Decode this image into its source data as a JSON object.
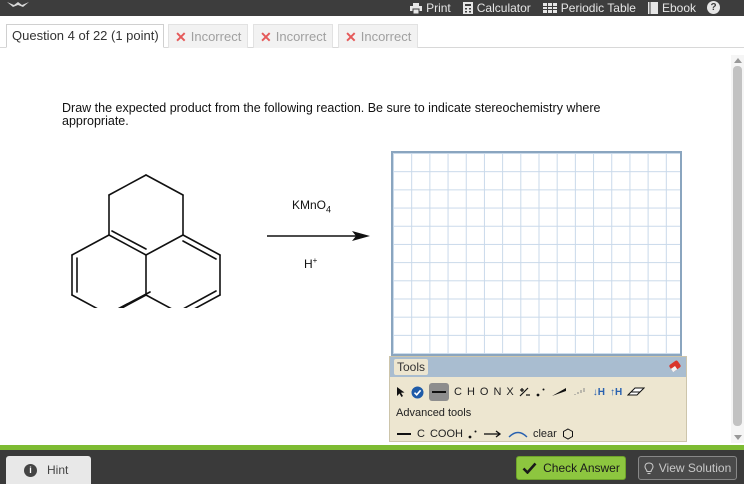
{
  "topbar": {
    "logo_icon": "bird-logo-icon",
    "tools": [
      {
        "label": "Print",
        "icon": "printer-icon"
      },
      {
        "label": "Calculator",
        "icon": "calculator-icon"
      },
      {
        "label": "Periodic Table",
        "icon": "periodic-table-icon"
      },
      {
        "label": "Ebook",
        "icon": "book-icon"
      }
    ],
    "help_glyph": "?"
  },
  "tabs": {
    "active": "Question 4 of 22 (1 point)",
    "attempts": [
      "Incorrect",
      "Incorrect",
      "Incorrect"
    ]
  },
  "question": {
    "prompt": "Draw the expected product from the following reaction. Be sure to indicate stereochemistry where appropriate.",
    "reagent_top_main": "KMnO",
    "reagent_top_sub": "4",
    "reagent_bottom_main": "H",
    "reagent_bottom_sup": "+"
  },
  "tools_panel": {
    "header": "Tools",
    "atoms": [
      "C",
      "H",
      "O",
      "N",
      "X"
    ],
    "wedge_up_label": "H",
    "wedge_down_label": "H",
    "advanced_label": "Advanced tools",
    "advanced_items": [
      "C",
      "COOH"
    ],
    "clear_label": "clear"
  },
  "footer": {
    "hint_label": "Hint",
    "check_label": "Check Answer",
    "view_label": "View Solution"
  },
  "colors": {
    "accent_green": "#8dc63f",
    "incorrect_red": "#e55a5a",
    "grid_line": "#c9d9ea"
  }
}
